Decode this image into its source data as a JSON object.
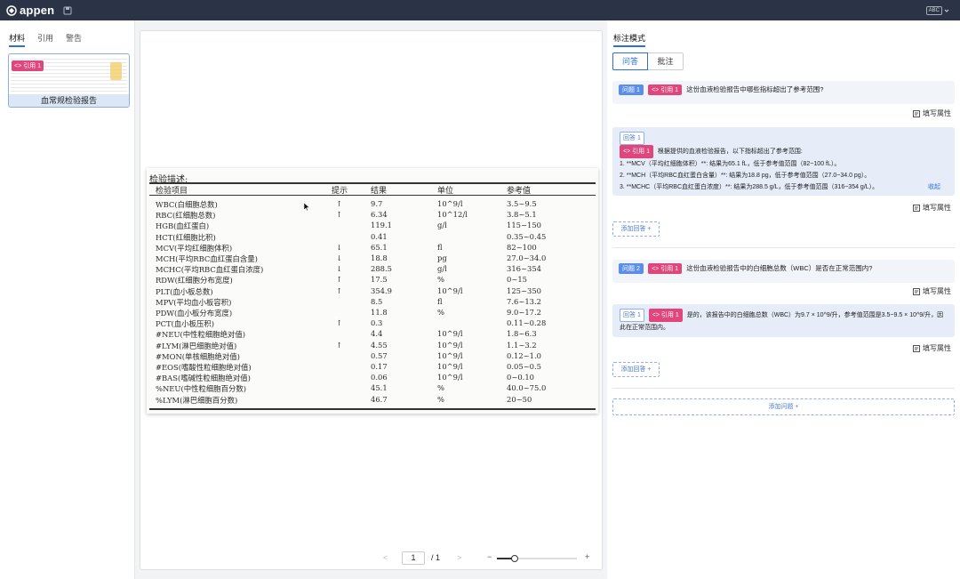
{
  "app": {
    "name": "appen",
    "keyboard_badge": "ABC"
  },
  "left_panel": {
    "tabs": [
      "材料",
      "引用",
      "警告"
    ],
    "thumbnail": {
      "ref_tag": "<> 引用 1",
      "caption": "血常规检验报告"
    }
  },
  "document": {
    "title": "检验描述:",
    "headers": [
      "检验项目",
      "提示",
      "结果",
      "单位",
      "参考值"
    ],
    "rows": [
      [
        "WBC(白细胞总数)",
        "↑",
        "9.7",
        "10^9/l",
        "3.5~9.5"
      ],
      [
        "RBC(红细胞总数)",
        "↑",
        "6.34",
        "10^12/l",
        "3.8~5.1"
      ],
      [
        "HGB(血红蛋白)",
        "",
        "119.1",
        "g/l",
        "115~150"
      ],
      [
        "HCT(红细胞比积)",
        "",
        "0.41",
        "",
        "0.35~0.45"
      ],
      [
        "MCV(平均红细胞体积)",
        "↓",
        "65.1",
        "fl",
        "82~100"
      ],
      [
        "MCH(平均RBC血红蛋白含量)",
        "↓",
        "18.8",
        "pg",
        "27.0~34.0"
      ],
      [
        "MCHC(平均RBC血红蛋白浓度)",
        "↓",
        "288.5",
        "g/l",
        "316~354"
      ],
      [
        "RDW(红细胞分布宽度)",
        "↑",
        "17.5",
        "%",
        "0~15"
      ],
      [
        "PLT(血小板总数)",
        "↑",
        "354.9",
        "10^9/l",
        "125~350"
      ],
      [
        "MPV(平均血小板容积)",
        "",
        "8.5",
        "fl",
        "7.6~13.2"
      ],
      [
        "PDW(血小板分布宽度)",
        "",
        "11.8",
        "%",
        "9.0~17.2"
      ],
      [
        "PCT(血小板压积)",
        "↑",
        "0.3",
        "",
        "0.11~0.28"
      ],
      [
        "#NEU(中性粒细胞绝对值)",
        "",
        "4.4",
        "10^9/l",
        "1.8~6.3"
      ],
      [
        "#LYM(淋巴细胞绝对值)",
        "↑",
        "4.55",
        "10^9/l",
        "1.1~3.2"
      ],
      [
        "#MON(单核细胞绝对值)",
        "",
        "0.57",
        "10^9/l",
        "0.12~1.0"
      ],
      [
        "#EOS(嗜酸性粒细胞绝对值)",
        "",
        "0.17",
        "10^9/l",
        "0.05~0.5"
      ],
      [
        "#BAS(嗜碱性粒细胞绝对值)",
        "",
        "0.06",
        "10^9/l",
        "0~0.10"
      ],
      [
        "%NEU(中性粒细胞百分数)",
        "",
        "45.1",
        "%",
        "40.0~75.0"
      ],
      [
        "%LYM(淋巴细胞百分数)",
        "",
        "46.7",
        "%",
        "20~50"
      ]
    ]
  },
  "pager": {
    "prev": "<",
    "current": "1",
    "total": "/ 1",
    "next": ">",
    "zoom_out": "−",
    "zoom_in": "+",
    "zoom_level": 0.22
  },
  "right_panel": {
    "title": "标注模式",
    "modes": [
      "问答",
      "批注"
    ],
    "fill_props": "填写属性",
    "add_answer": "添加回答  +",
    "add_question": "添加问题  +",
    "q1": {
      "tag": "问题 1",
      "ref": "<> 引用 1",
      "text": "这份血液检验报告中哪些指标超出了参考范围?",
      "answer_tag": "回答 1",
      "answer_ref": "<> 引用 1",
      "answer_intro": "根据提供的血液检验报告，以下指标超出了参考范围:",
      "answer_lines": [
        "1. **MCV（平均红细胞体积）**: 结果为65.1 fL，低于参考值范围（82~100 fL）。",
        "2. **MCH（平均RBC血红蛋白含量）**: 结果为18.8 pg，低于参考值范围（27.0~34.0 pg）。",
        "3. **MCHC（平均RBC血红蛋白浓度）**: 结果为288.5 g/L，低于参考值范围（316~354 g/L）。"
      ],
      "collapse": "收起"
    },
    "q2": {
      "tag": "问题 2",
      "ref": "<> 引用 1",
      "text": "这份血液检验报告中的白细胞总数（WBC）是否在正常范围内?",
      "answer_tag": "回答 1",
      "answer_ref": "<> 引用 1",
      "answer_text": "是的，该报告中的白细胞总数（WBC）为9.7 × 10^9/升，参考值范围是3.5~9.5 × 10^9/升，因此在正常范围内。"
    }
  }
}
